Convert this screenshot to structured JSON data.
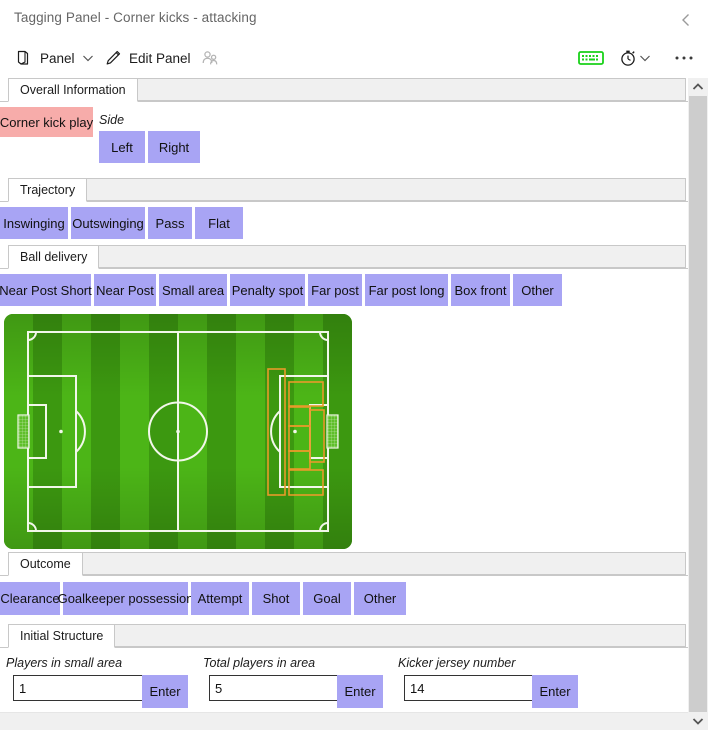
{
  "window": {
    "title": "Tagging Panel - Corner kicks - attacking",
    "collapse_icon": "chevron-left-icon"
  },
  "toolbar": {
    "panel_label": "Panel",
    "panel_icon": "panel-book-icon",
    "panel_dropdown_icon": "chevron-down-icon",
    "edit_panel_label": "Edit Panel",
    "edit_panel_icon": "pencil-icon",
    "people_icon": "people-icon",
    "keyboard_icon": "keyboard-icon",
    "keyboard_color": "#19d119",
    "timer_icon": "stopwatch-icon",
    "timer_dropdown_icon": "chevron-down-icon",
    "more_icon": "ellipsis-icon"
  },
  "colors": {
    "tag": "#a8a4f4",
    "tag_selected": "#f7acaa",
    "pitch_dark": "#3a9410",
    "pitch_light": "#4cb517",
    "zone_outline": "#e89b2a",
    "pitch_lines": "#f2f7ea"
  },
  "groups": [
    {
      "id": "overall-information",
      "tab_label": "Overall Information",
      "selected_tag": "Corner kick play",
      "field_label": "Side",
      "side_options": [
        "Left",
        "Right"
      ]
    },
    {
      "id": "trajectory",
      "tab_label": "Trajectory",
      "tags": [
        "Inswinging",
        "Outswinging",
        "Pass",
        "Flat"
      ]
    },
    {
      "id": "ball-delivery",
      "tab_label": "Ball delivery",
      "tags": [
        "Near Post Short",
        "Near Post",
        "Small area",
        "Penalty spot",
        "Far post",
        "Far post long",
        "Box front",
        "Other"
      ]
    },
    {
      "id": "outcome",
      "tab_label": "Outcome",
      "tags": [
        "Clearance",
        "Goalkeeper possession",
        "Attempt",
        "Shot",
        "Goal",
        "Other"
      ]
    },
    {
      "id": "initial-structure",
      "tab_label": "Initial Structure",
      "fields": [
        {
          "label": "Players in small area",
          "value": "1",
          "button": "Enter"
        },
        {
          "label": "Total players in area",
          "value": "5",
          "button": "Enter"
        },
        {
          "label": "Kicker jersey number",
          "value": "14",
          "button": "Enter"
        }
      ]
    }
  ],
  "pitch": {
    "name": "football-pitch-zone-selector",
    "stripes": 12,
    "zones_side": "right",
    "zone_count": 8
  },
  "scrollbar": {
    "up_icon": "chevron-up-icon",
    "down_icon": "chevron-down-icon"
  }
}
